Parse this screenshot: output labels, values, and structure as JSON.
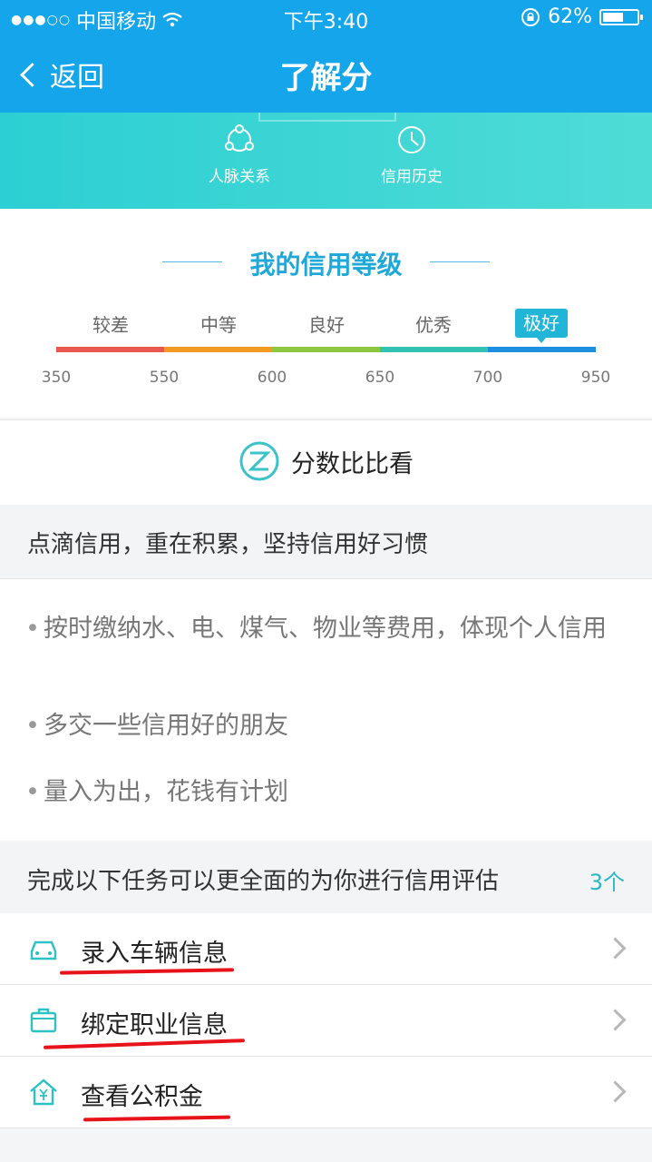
{
  "status": {
    "carrier": "中国移动",
    "time": "下午3:40",
    "battery": "62%",
    "battery_level": 0.62
  },
  "nav": {
    "back_label": "返回",
    "title": "了解分"
  },
  "band": {
    "items": [
      {
        "label": "人脉关系",
        "icon": "people-network-icon"
      },
      {
        "label": "信用历史",
        "icon": "clock-history-icon"
      }
    ]
  },
  "credit_level": {
    "title": "我的信用等级",
    "levels": [
      "较差",
      "中等",
      "良好",
      "优秀",
      "极好"
    ],
    "active_level": "极好",
    "ticks": [
      "350",
      "550",
      "600",
      "650",
      "700",
      "950"
    ],
    "colors": [
      "#e9584f",
      "#f39a23",
      "#8dc63f",
      "#31c2b2",
      "#1e8fe0"
    ]
  },
  "compare": {
    "label": "分数比比看",
    "icon": "z-circle-icon"
  },
  "tips": {
    "heading": "点滴信用，重在积累，坚持信用好习惯",
    "items": [
      "按时缴纳水、电、煤气、物业等费用，体现个人信用",
      "多交一些信用好的朋友",
      "量入为出，花钱有计划"
    ]
  },
  "tasks": {
    "heading": "完成以下任务可以更全面的为你进行信用评估",
    "count": "3个",
    "items": [
      {
        "label": "录入车辆信息",
        "icon": "car-icon"
      },
      {
        "label": "绑定职业信息",
        "icon": "briefcase-icon"
      },
      {
        "label": "查看公积金",
        "icon": "house-yen-icon"
      }
    ]
  }
}
